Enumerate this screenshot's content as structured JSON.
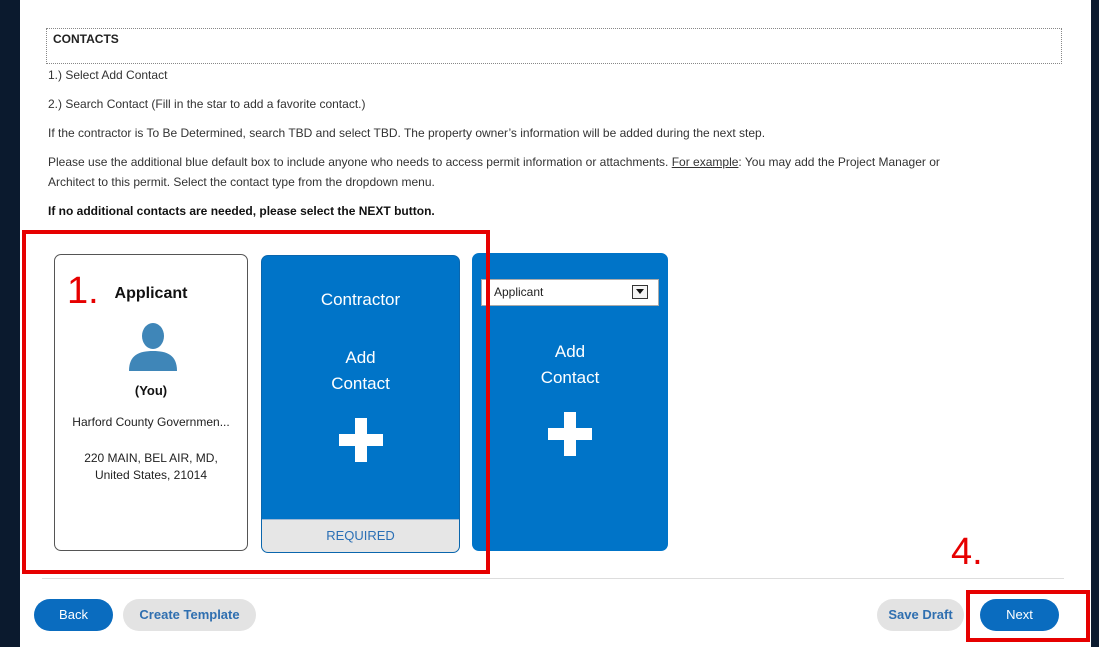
{
  "header": {
    "title": "CONTACTS"
  },
  "instructions": {
    "step1": "1.) Select Add Contact",
    "step2": "2.) Search Contact (Fill in the star to add a favorite contact.)",
    "tbd_note": "If the contractor is To Be Determined, search TBD and select TBD. The property owner’s information will be added during the next step.",
    "extra_line1_pre": "Please use the additional blue default box to include anyone who needs to access permit information or attachments. ",
    "extra_line1_link": "For example",
    "extra_line1_post": ": You may add the Project Manager or",
    "extra_line2": "Architect to this permit.  Select the contact type from the dropdown menu.",
    "no_more_note": "If no additional contacts are needed, please select the NEXT button."
  },
  "applicant_card": {
    "title": "Applicant",
    "you": "(You)",
    "organization": "Harford County Governmen...",
    "address_line1": "220 MAIN, BEL AIR, MD,",
    "address_line2": "United States, 21014"
  },
  "contractor_card": {
    "type": "Contractor",
    "add_line1": "Add",
    "add_line2": "Contact",
    "required": "REQUIRED"
  },
  "extra_card": {
    "selected_type": "Applicant",
    "add_line1": "Add",
    "add_line2": "Contact"
  },
  "buttons": {
    "back": "Back",
    "create_template": "Create Template",
    "save_draft": "Save Draft",
    "next": "Next"
  },
  "annotations": {
    "box1_label": "1.",
    "box4_label": "4."
  },
  "colors": {
    "primary_blue": "#0074c8",
    "annotation_red": "#e60000"
  }
}
